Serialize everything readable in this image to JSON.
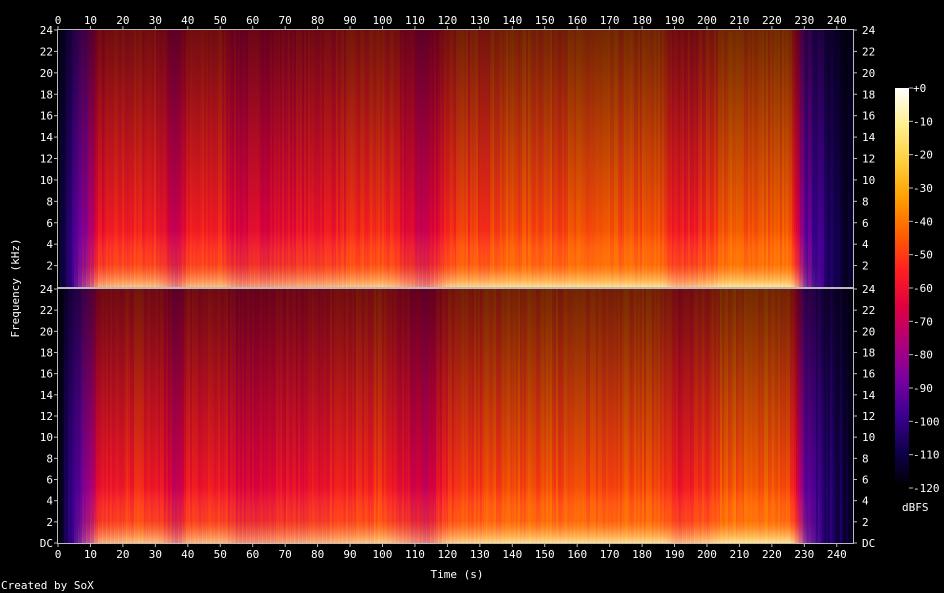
{
  "chart_data": {
    "type": "heatmap",
    "title": "",
    "xlabel": "Time (s)",
    "ylabel": "Frequency (kHz)",
    "xlim": [
      0,
      245
    ],
    "x_ticks": [
      0,
      10,
      20,
      30,
      40,
      50,
      60,
      70,
      80,
      90,
      100,
      110,
      120,
      130,
      140,
      150,
      160,
      170,
      180,
      190,
      200,
      210,
      220,
      230,
      240
    ],
    "channels": 2,
    "ylim_khz": [
      0,
      24
    ],
    "y_ticks": [
      "DC",
      "2",
      "4",
      "6",
      "8",
      "10",
      "12",
      "14",
      "16",
      "18",
      "20",
      "22",
      "24"
    ],
    "colorbar": {
      "label": "dBFS",
      "range": [
        -120,
        0
      ],
      "ticks": [
        "+0",
        "-10",
        "-20",
        "-30",
        "-40",
        "-50",
        "-60",
        "-70",
        "-80",
        "-90",
        "-100",
        "-110",
        "-120"
      ],
      "colors": [
        "#000000",
        "#10004a",
        "#3a0090",
        "#7a00a0",
        "#b0007a",
        "#e00040",
        "#ff2020",
        "#ff6000",
        "#ffa000",
        "#ffd040",
        "#fff090",
        "#ffffff"
      ]
    },
    "energy_profile": {
      "description_free_times": [
        0,
        5,
        10,
        12,
        20,
        30,
        36,
        40,
        50,
        55,
        100,
        113,
        117,
        120,
        140,
        186,
        190,
        200,
        205,
        225,
        230,
        235,
        245
      ],
      "level_db": [
        -115,
        -95,
        -75,
        -60,
        -55,
        -55,
        -70,
        -57,
        -55,
        -65,
        -52,
        -70,
        -60,
        -52,
        -47,
        -47,
        -58,
        -52,
        -45,
        -45,
        -90,
        -100,
        -115
      ]
    },
    "footer_text": "Created by SoX"
  }
}
